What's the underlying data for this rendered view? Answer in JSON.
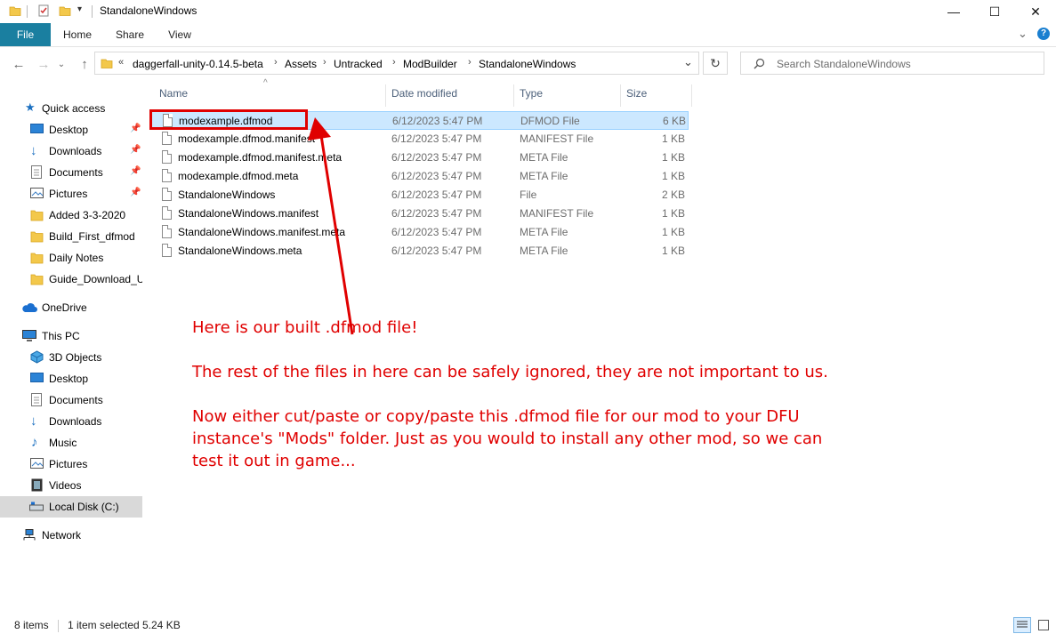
{
  "window": {
    "title": "StandaloneWindows",
    "minimize_glyph": "—",
    "maximize_glyph": "☐",
    "close_glyph": "✕"
  },
  "ribbon": {
    "tabs": [
      "File",
      "Home",
      "Share",
      "View"
    ],
    "expand_glyph": "⌄",
    "help_glyph": "?"
  },
  "address": {
    "overflow": "«",
    "crumbs": [
      "daggerfall-unity-0.14.5-beta",
      "Assets",
      "Untracked",
      "ModBuilder",
      "StandaloneWindows"
    ],
    "separator": "›",
    "dropdown_glyph": "⌄",
    "refresh_glyph": "↻"
  },
  "search": {
    "placeholder": "Search StandaloneWindows"
  },
  "nav_pane": {
    "quick_access": "Quick access",
    "pinned": [
      "Desktop",
      "Downloads",
      "Documents",
      "Pictures"
    ],
    "pin_glyph": "📌",
    "folders": [
      "Added 3-3-2020",
      "Build_First_dfmod",
      "Daily Notes",
      "Guide_Download_U"
    ],
    "onedrive": "OneDrive",
    "this_pc": "This PC",
    "pc_items": [
      "3D Objects",
      "Desktop",
      "Documents",
      "Downloads",
      "Music",
      "Pictures",
      "Videos",
      "Local Disk (C:)"
    ],
    "network": "Network"
  },
  "columns": {
    "name": "Name",
    "date": "Date modified",
    "type": "Type",
    "size": "Size",
    "sort_glyph": "^"
  },
  "files": [
    {
      "name": "modexample.dfmod",
      "date": "6/12/2023 5:47 PM",
      "type": "DFMOD File",
      "size": "6 KB",
      "selected": true
    },
    {
      "name": "modexample.dfmod.manifest",
      "date": "6/12/2023 5:47 PM",
      "type": "MANIFEST File",
      "size": "1 KB"
    },
    {
      "name": "modexample.dfmod.manifest.meta",
      "date": "6/12/2023 5:47 PM",
      "type": "META File",
      "size": "1 KB"
    },
    {
      "name": "modexample.dfmod.meta",
      "date": "6/12/2023 5:47 PM",
      "type": "META File",
      "size": "1 KB"
    },
    {
      "name": "StandaloneWindows",
      "date": "6/12/2023 5:47 PM",
      "type": "File",
      "size": "2 KB"
    },
    {
      "name": "StandaloneWindows.manifest",
      "date": "6/12/2023 5:47 PM",
      "type": "MANIFEST File",
      "size": "1 KB"
    },
    {
      "name": "StandaloneWindows.manifest.meta",
      "date": "6/12/2023 5:47 PM",
      "type": "META File",
      "size": "1 KB"
    },
    {
      "name": "StandaloneWindows.meta",
      "date": "6/12/2023 5:47 PM",
      "type": "META File",
      "size": "1 KB"
    }
  ],
  "annotation": {
    "color": "#e00000",
    "line1": "Here is our built .dfmod file!",
    "line2": "The rest of the files in here can be safely ignored, they are not important to us.",
    "line3a": "Now either cut/paste or copy/paste this .dfmod file for our mod to your DFU",
    "line3b": "instance's \"Mods\" folder. Just as you would to install any other mod, so we can",
    "line3c": "test it out in game..."
  },
  "status": {
    "items": "8 items",
    "selected": "1 item selected",
    "size": "5.24 KB"
  },
  "colors": {
    "accent": "#1a7fa0",
    "selection": "#cce8ff",
    "header_text": "#4c607a"
  }
}
